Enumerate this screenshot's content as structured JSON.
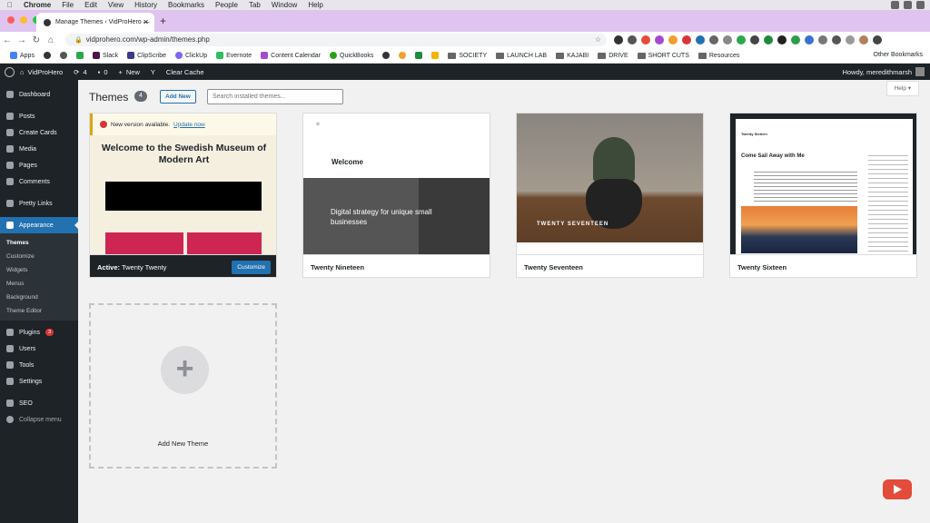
{
  "macbar": {
    "menus": [
      "Chrome",
      "File",
      "Edit",
      "View",
      "History",
      "Bookmarks",
      "People",
      "Tab",
      "Window",
      "Help"
    ]
  },
  "browser": {
    "tab_title": "Manage Themes ‹ VidProHero —",
    "url": "vidprohero.com/wp-admin/themes.php",
    "bookmarks": [
      "Apps",
      "Slack",
      "ClipScribe",
      "ClickUp",
      "Evernote",
      "Content Calendar",
      "QuickBooks",
      "SOCIETY",
      "LAUNCH LAB",
      "KAJABI",
      "DRIVE",
      "SHORT CUTS",
      "Resources"
    ],
    "other_bookmarks": "Other Bookmarks"
  },
  "wpbar": {
    "site": "VidProHero",
    "updates": "4",
    "comments": "0",
    "new": "New",
    "clear_cache": "Clear Cache",
    "howdy": "Howdy, meredithmarsh"
  },
  "sidebar": {
    "items": [
      "Dashboard",
      "Posts",
      "Create Cards",
      "Media",
      "Pages",
      "Comments",
      "Pretty Links",
      "Appearance"
    ],
    "submenu": [
      "Themes",
      "Customize",
      "Widgets",
      "Menus",
      "Background",
      "Theme Editor"
    ],
    "after": [
      "Plugins",
      "Users",
      "Tools",
      "Settings",
      "SEO",
      "Collapse menu"
    ],
    "plugins_badge": "3"
  },
  "main": {
    "title": "Themes",
    "count": "4",
    "add_new": "Add New",
    "search_placeholder": "Search installed themes...",
    "help": "Help ▾",
    "add_new_theme": "Add New Theme"
  },
  "themes": [
    {
      "name": "Twenty Twenty",
      "active_label": "Active:",
      "customize": "Customize",
      "notice": "New version available.",
      "notice_link": "Update now",
      "preview_heading": "Welcome to the Swedish Museum of Modern Art"
    },
    {
      "name": "Twenty Nineteen",
      "preview_welcome": "Welcome",
      "preview_tagline": "Digital strategy for unique small businesses"
    },
    {
      "name": "Twenty Seventeen",
      "preview_text": "TWENTY SEVENTEEN"
    },
    {
      "name": "Twenty Sixteen",
      "preview_site": "Twenty Sixteen",
      "preview_post": "Come Sail Away with Me"
    }
  ]
}
